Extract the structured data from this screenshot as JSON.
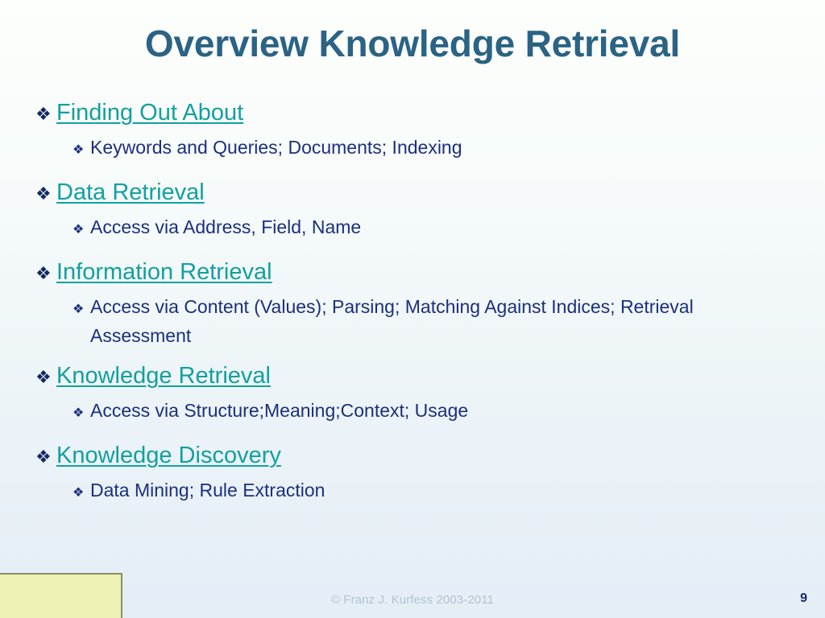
{
  "slide": {
    "title": "Overview Knowledge Retrieval",
    "bullet_level1_glyph": "❖",
    "bullet_level2_glyph": "❖",
    "colors": {
      "title": "#2a6384",
      "level1_text": "#12a0a0",
      "level1_bullet": "#12285f",
      "level2_text": "#1b2f7e",
      "level2_bullet": "#1b2f7e",
      "background_top": "#fdfffd",
      "background_bottom": "#e4edf5",
      "note_box_fill": "#eef2b4",
      "note_box_border": "#8a8f64",
      "copyright": "#b2c3cf",
      "page_number": "#12285f"
    },
    "groups": [
      {
        "heading": "Finding Out About",
        "sub": "Keywords and Queries; Documents; Indexing"
      },
      {
        "heading": "Data Retrieval",
        "sub": "Access via Address, Field, Name"
      },
      {
        "heading": "Information Retrieval",
        "sub": "Access via Content (Values); Parsing; Matching Against Indices; Retrieval Assessment"
      },
      {
        "heading": "Knowledge Retrieval",
        "sub": "Access via Structure;Meaning;Context; Usage"
      },
      {
        "heading": "Knowledge Discovery",
        "sub": "Data Mining; Rule Extraction"
      }
    ]
  },
  "footer": {
    "copyright": "© Franz J. Kurfess 2003-2011",
    "page_number": "9"
  }
}
